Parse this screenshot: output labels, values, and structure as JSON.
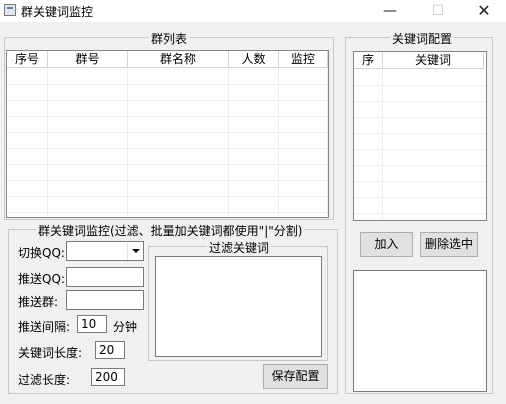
{
  "window": {
    "title": "群关键词监控",
    "minimize_glyph": "—",
    "maximize_glyph": "☐",
    "close_glyph": "✕"
  },
  "group_list": {
    "legend": "群列表",
    "columns": [
      "序号",
      "群号",
      "群名称",
      "人数",
      "监控"
    ]
  },
  "keyword_config": {
    "legend": "关键词配置",
    "columns": [
      "序",
      "关键词"
    ],
    "add_button": "加入",
    "delete_button": "删除选中"
  },
  "monitor": {
    "legend": "群关键词监控(过滤、批量加关键词都使用\"|\"分割)",
    "switch_qq_label": "切换QQ:",
    "switch_qq_value": "",
    "push_qq_label": "推送QQ:",
    "push_qq_value": "",
    "push_group_label": "推送群:",
    "push_group_value": "",
    "push_interval_label": "推送间隔:",
    "push_interval_value": "10",
    "push_interval_unit": "分钟",
    "keyword_length_label": "关键词长度:",
    "keyword_length_value": "20",
    "filter_length_label": "过滤长度:",
    "filter_length_value": "200",
    "filter_keywords_legend": "过滤关键词",
    "save_button": "保存配置"
  }
}
